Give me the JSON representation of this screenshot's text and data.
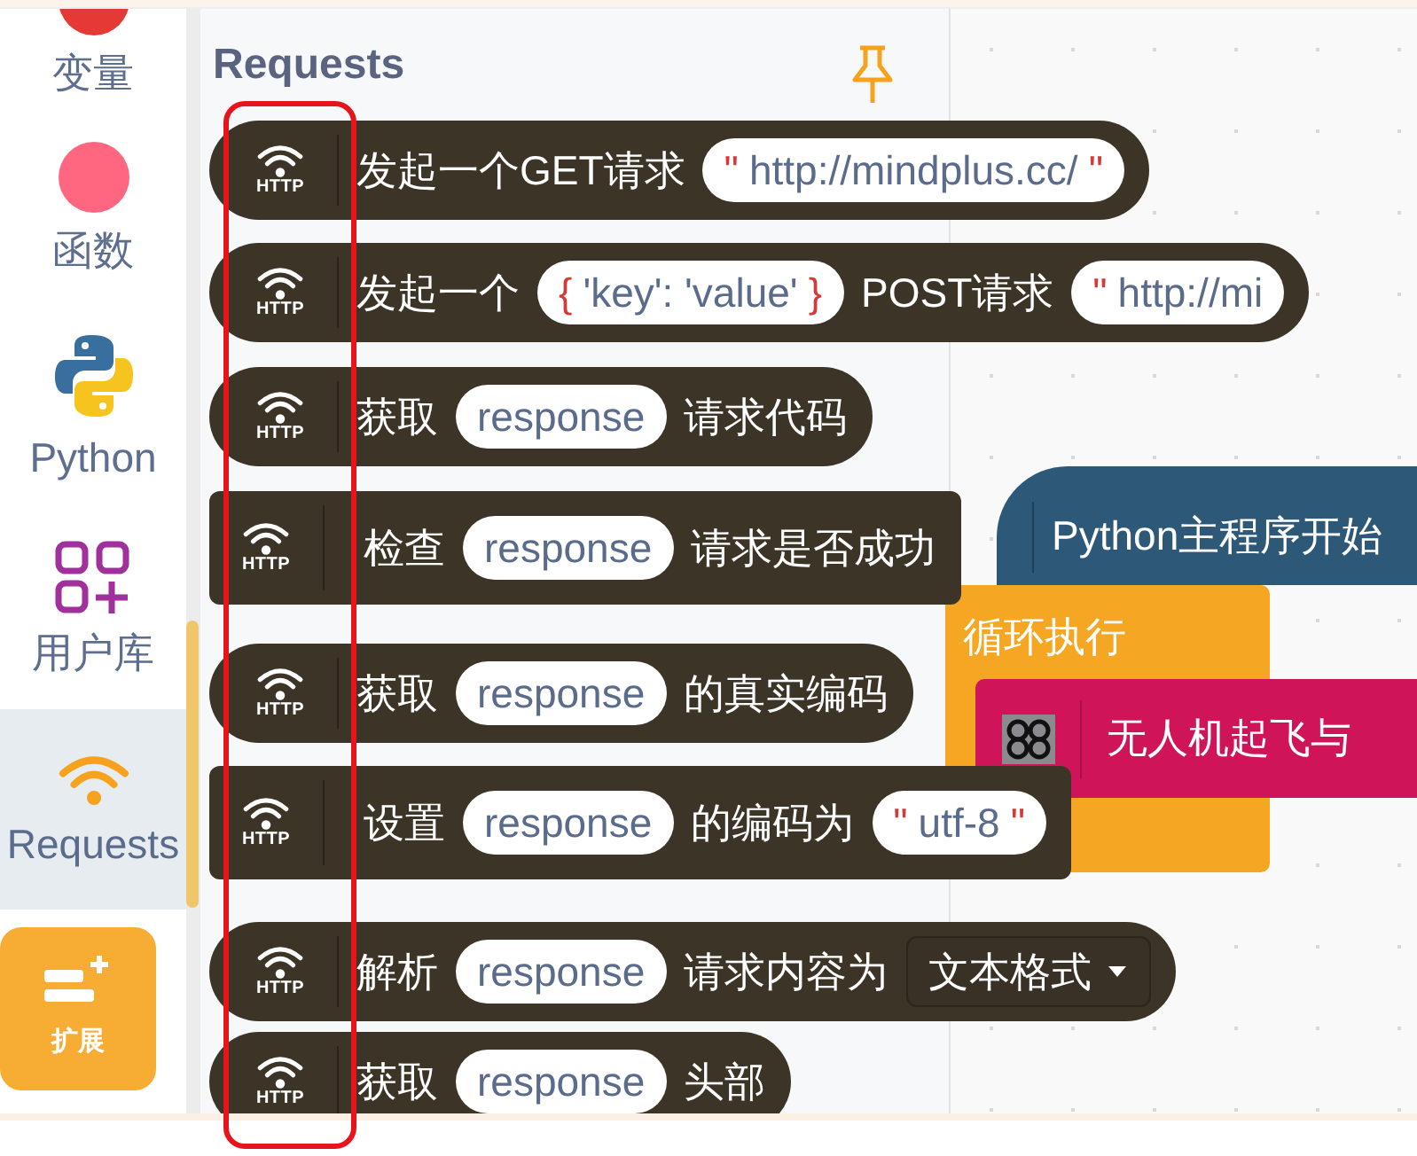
{
  "sidebar": {
    "items": [
      {
        "label": "变量",
        "kind": "circle",
        "color": "#e53935",
        "selected": false
      },
      {
        "label": "函数",
        "kind": "circle",
        "color": "#ff6680",
        "selected": false
      },
      {
        "label": "Python",
        "kind": "python",
        "selected": false
      },
      {
        "label": "用户库",
        "kind": "library",
        "selected": false
      },
      {
        "label": "Requests",
        "kind": "wifi",
        "selected": true
      }
    ],
    "extension_button": {
      "label": "扩展"
    }
  },
  "flyout": {
    "title": "Requests",
    "blocks": [
      {
        "kind": "reporter",
        "icon_label": "HTTP",
        "parts": [
          {
            "kind": "text",
            "text": "发起一个GET请求"
          },
          {
            "kind": "string",
            "open": "\"",
            "text": "http://mindplus.cc/",
            "close": "\""
          }
        ]
      },
      {
        "kind": "reporter",
        "icon_label": "HTTP",
        "parts": [
          {
            "kind": "text",
            "text": "发起一个"
          },
          {
            "kind": "dict",
            "open": "{",
            "text": "'key': 'value'",
            "close": "}"
          },
          {
            "kind": "text",
            "text": "POST请求"
          },
          {
            "kind": "string",
            "open": "\"",
            "text": "http://mi"
          }
        ]
      },
      {
        "kind": "reporter",
        "icon_label": "HTTP",
        "parts": [
          {
            "kind": "text",
            "text": "获取"
          },
          {
            "kind": "variable",
            "text": "response"
          },
          {
            "kind": "text",
            "text": "请求代码"
          }
        ]
      },
      {
        "kind": "command",
        "icon_label": "HTTP",
        "parts": [
          {
            "kind": "text",
            "text": "检查"
          },
          {
            "kind": "variable",
            "text": "response"
          },
          {
            "kind": "text",
            "text": "请求是否成功"
          }
        ]
      },
      {
        "kind": "reporter",
        "icon_label": "HTTP",
        "parts": [
          {
            "kind": "text",
            "text": "获取"
          },
          {
            "kind": "variable",
            "text": "response"
          },
          {
            "kind": "text",
            "text": "的真实编码"
          }
        ]
      },
      {
        "kind": "command",
        "icon_label": "HTTP",
        "parts": [
          {
            "kind": "text",
            "text": "设置"
          },
          {
            "kind": "variable",
            "text": "response"
          },
          {
            "kind": "text",
            "text": "的编码为"
          },
          {
            "kind": "string",
            "open": "\"",
            "text": "utf-8",
            "close": "\""
          }
        ]
      },
      {
        "kind": "reporter",
        "icon_label": "HTTP",
        "parts": [
          {
            "kind": "text",
            "text": "解析"
          },
          {
            "kind": "variable",
            "text": "response"
          },
          {
            "kind": "text",
            "text": "请求内容为"
          },
          {
            "kind": "dropdown",
            "text": "文本格式"
          }
        ]
      },
      {
        "kind": "reporter",
        "icon_label": "HTTP",
        "parts": [
          {
            "kind": "text",
            "text": "获取"
          },
          {
            "kind": "variable",
            "text": "response"
          },
          {
            "kind": "text",
            "text": "头部"
          }
        ]
      }
    ]
  },
  "workspace": {
    "blocks": [
      {
        "kind": "hat",
        "text": "Python主程序开始"
      },
      {
        "kind": "loop",
        "text": "循环执行"
      },
      {
        "kind": "command",
        "text": "无人机起飞与"
      }
    ]
  }
}
